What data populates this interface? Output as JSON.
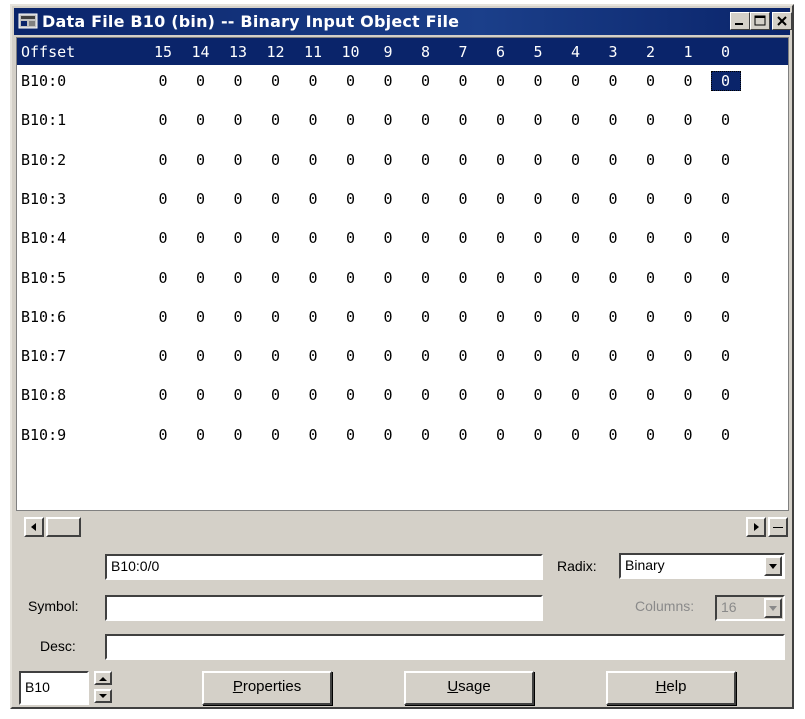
{
  "window": {
    "title": "Data File B10 (bin) -- Binary Input Object File"
  },
  "grid": {
    "offset_header": "Offset",
    "bit_headers": [
      "15",
      "14",
      "13",
      "12",
      "11",
      "10",
      "9",
      "8",
      "7",
      "6",
      "5",
      "4",
      "3",
      "2",
      "1",
      "0"
    ],
    "rows": [
      {
        "label": "B10:0",
        "bits": [
          "0",
          "0",
          "0",
          "0",
          "0",
          "0",
          "0",
          "0",
          "0",
          "0",
          "0",
          "0",
          "0",
          "0",
          "0",
          "0"
        ]
      },
      {
        "label": "B10:1",
        "bits": [
          "0",
          "0",
          "0",
          "0",
          "0",
          "0",
          "0",
          "0",
          "0",
          "0",
          "0",
          "0",
          "0",
          "0",
          "0",
          "0"
        ]
      },
      {
        "label": "B10:2",
        "bits": [
          "0",
          "0",
          "0",
          "0",
          "0",
          "0",
          "0",
          "0",
          "0",
          "0",
          "0",
          "0",
          "0",
          "0",
          "0",
          "0"
        ]
      },
      {
        "label": "B10:3",
        "bits": [
          "0",
          "0",
          "0",
          "0",
          "0",
          "0",
          "0",
          "0",
          "0",
          "0",
          "0",
          "0",
          "0",
          "0",
          "0",
          "0"
        ]
      },
      {
        "label": "B10:4",
        "bits": [
          "0",
          "0",
          "0",
          "0",
          "0",
          "0",
          "0",
          "0",
          "0",
          "0",
          "0",
          "0",
          "0",
          "0",
          "0",
          "0"
        ]
      },
      {
        "label": "B10:5",
        "bits": [
          "0",
          "0",
          "0",
          "0",
          "0",
          "0",
          "0",
          "0",
          "0",
          "0",
          "0",
          "0",
          "0",
          "0",
          "0",
          "0"
        ]
      },
      {
        "label": "B10:6",
        "bits": [
          "0",
          "0",
          "0",
          "0",
          "0",
          "0",
          "0",
          "0",
          "0",
          "0",
          "0",
          "0",
          "0",
          "0",
          "0",
          "0"
        ]
      },
      {
        "label": "B10:7",
        "bits": [
          "0",
          "0",
          "0",
          "0",
          "0",
          "0",
          "0",
          "0",
          "0",
          "0",
          "0",
          "0",
          "0",
          "0",
          "0",
          "0"
        ]
      },
      {
        "label": "B10:8",
        "bits": [
          "0",
          "0",
          "0",
          "0",
          "0",
          "0",
          "0",
          "0",
          "0",
          "0",
          "0",
          "0",
          "0",
          "0",
          "0",
          "0"
        ]
      },
      {
        "label": "B10:9",
        "bits": [
          "0",
          "0",
          "0",
          "0",
          "0",
          "0",
          "0",
          "0",
          "0",
          "0",
          "0",
          "0",
          "0",
          "0",
          "0",
          "0"
        ]
      }
    ],
    "selected_cell": "B10:0/0"
  },
  "address_field": {
    "value": "B10:0/0"
  },
  "radix": {
    "label": "Radix:",
    "value": "Binary"
  },
  "symbol": {
    "label": "Symbol:",
    "value": ""
  },
  "columns": {
    "label": "Columns:",
    "value": "16"
  },
  "desc": {
    "label": "Desc:",
    "value": ""
  },
  "file_spinner": {
    "value": "B10"
  },
  "buttons": {
    "properties": {
      "accel": "P",
      "rest": "roperties"
    },
    "usage": {
      "accel": "U",
      "rest": "sage"
    },
    "help": {
      "accel": "H",
      "rest": "elp"
    }
  },
  "colors": {
    "titlebar": "#0a246a",
    "face": "#d4d0c8"
  },
  "icons": [
    "app-icon",
    "minimize-icon",
    "maximize-icon",
    "close-icon",
    "scroll-left-icon",
    "scroll-right-icon",
    "split-icon",
    "dropdown-arrow-icon",
    "spin-up-icon",
    "spin-down-icon"
  ]
}
